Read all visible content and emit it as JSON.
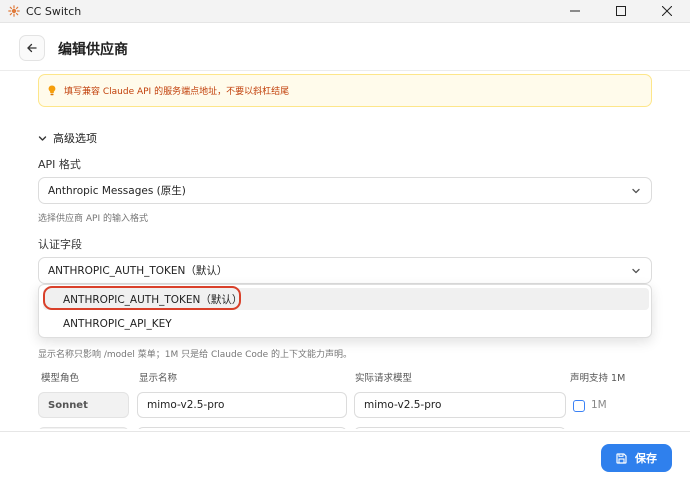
{
  "window": {
    "title": "CC Switch"
  },
  "header": {
    "title": "编辑供应商"
  },
  "tip": {
    "text": "填写兼容 Claude API 的服务端点地址，不要以斜杠结尾"
  },
  "advanced": {
    "label": "高级选项"
  },
  "api_format": {
    "label": "API 格式",
    "value": "Anthropic Messages (原生)",
    "hint": "选择供应商 API 的输入格式"
  },
  "auth_field": {
    "label": "认证字段",
    "value": "ANTHROPIC_AUTH_TOKEN（默认）",
    "options": [
      "ANTHROPIC_AUTH_TOKEN（默认）",
      "ANTHROPIC_API_KEY"
    ]
  },
  "model_hint": "显示名称只影响 /model 菜单；1M 只是给 Claude Code 的上下文能力声明。",
  "model_table": {
    "headers": [
      "模型角色",
      "显示名称",
      "实际请求模型",
      "声明支持 1M"
    ],
    "rows": [
      {
        "role": "Sonnet",
        "display": "mimo-v2.5-pro",
        "actual": "mimo-v2.5-pro",
        "check_label": "1M"
      }
    ]
  },
  "footer": {
    "save_label": "保存"
  },
  "colors": {
    "accent": "#2f80ed",
    "highlight": "#d9402a",
    "tip_bg": "#fffbeb",
    "tip_text": "#c2410c"
  }
}
